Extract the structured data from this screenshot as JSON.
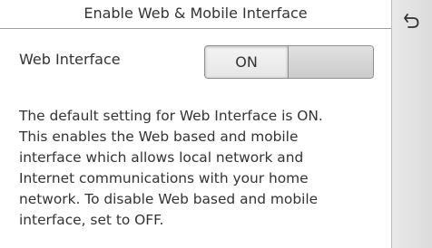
{
  "header": {
    "title": "Enable Web & Mobile Interface"
  },
  "setting": {
    "label": "Web Interface",
    "toggle_on_label": "ON",
    "value": "ON"
  },
  "description": "The default setting for Web Interface is ON.\nThis enables the Web based and mobile\ninterface which allows local network and\nInternet communications with your home\nnetwork.  To disable Web based and mobile\ninterface, set to OFF.",
  "sidebar": {
    "back_icon": "back-arrow-icon"
  },
  "colors": {
    "text": "#333333",
    "divider": "#9e9e9e",
    "sidebar": "#e3e3e3"
  }
}
